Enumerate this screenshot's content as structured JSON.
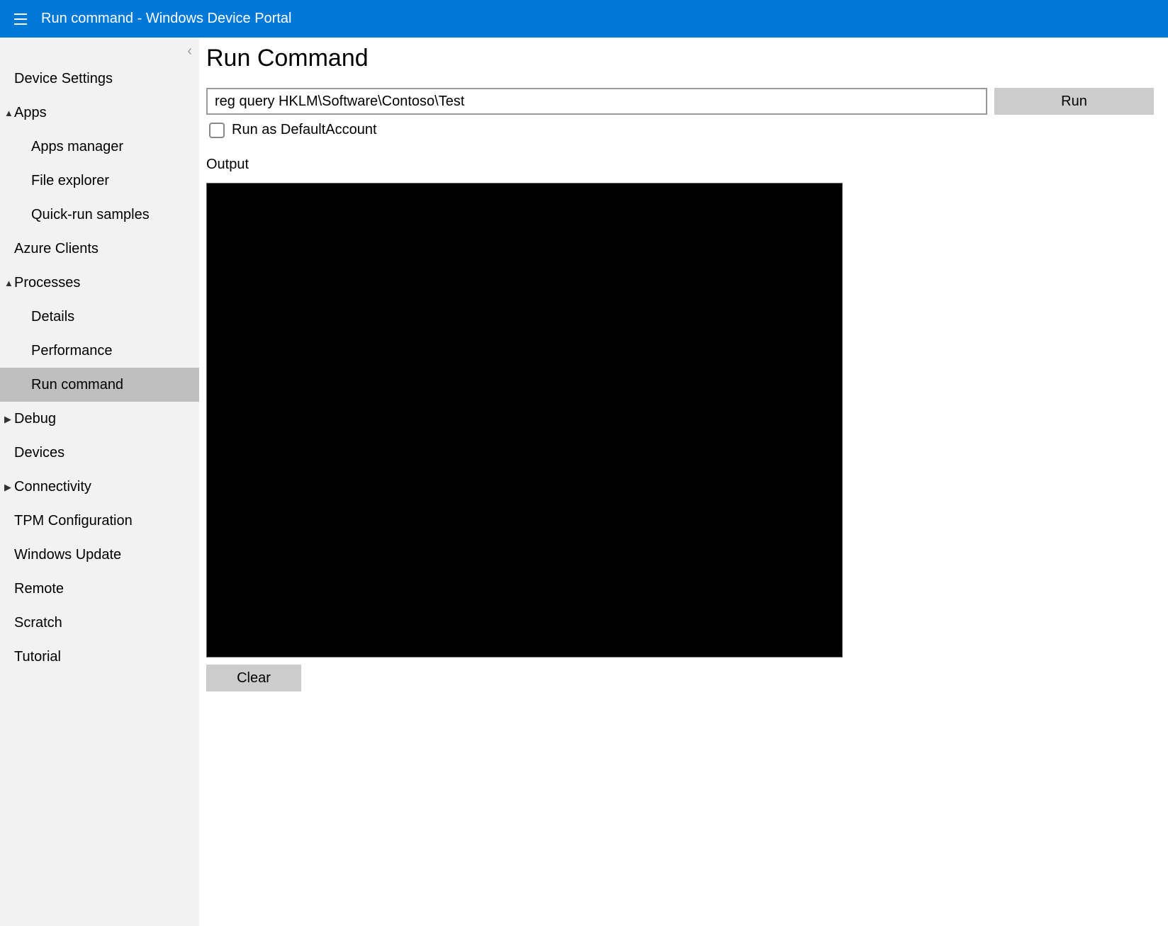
{
  "header": {
    "title": "Run command - Windows Device Portal"
  },
  "sidebar": {
    "items": [
      {
        "label": "Device Settings",
        "level": "top",
        "caret": "",
        "selected": false
      },
      {
        "label": "Apps",
        "level": "top",
        "caret": "▲",
        "selected": false
      },
      {
        "label": "Apps manager",
        "level": "sub",
        "caret": "",
        "selected": false
      },
      {
        "label": "File explorer",
        "level": "sub",
        "caret": "",
        "selected": false
      },
      {
        "label": "Quick-run samples",
        "level": "sub",
        "caret": "",
        "selected": false
      },
      {
        "label": "Azure Clients",
        "level": "top",
        "caret": "",
        "selected": false
      },
      {
        "label": "Processes",
        "level": "top",
        "caret": "▲",
        "selected": false
      },
      {
        "label": "Details",
        "level": "sub",
        "caret": "",
        "selected": false
      },
      {
        "label": "Performance",
        "level": "sub",
        "caret": "",
        "selected": false
      },
      {
        "label": "Run command",
        "level": "sub",
        "caret": "",
        "selected": true
      },
      {
        "label": "Debug",
        "level": "top",
        "caret": "▶",
        "selected": false
      },
      {
        "label": "Devices",
        "level": "top",
        "caret": "",
        "selected": false
      },
      {
        "label": "Connectivity",
        "level": "top",
        "caret": "▶",
        "selected": false
      },
      {
        "label": "TPM Configuration",
        "level": "top",
        "caret": "",
        "selected": false
      },
      {
        "label": "Windows Update",
        "level": "top",
        "caret": "",
        "selected": false
      },
      {
        "label": "Remote",
        "level": "top",
        "caret": "",
        "selected": false
      },
      {
        "label": "Scratch",
        "level": "top",
        "caret": "",
        "selected": false
      },
      {
        "label": "Tutorial",
        "level": "top",
        "caret": "",
        "selected": false
      }
    ],
    "collapse_glyph": "‹"
  },
  "main": {
    "title": "Run Command",
    "command_value": "reg query HKLM\\Software\\Contoso\\Test",
    "run_label": "Run",
    "run_as_default_label": "Run as DefaultAccount",
    "run_as_default_checked": false,
    "output_label": "Output",
    "output_text": "",
    "clear_label": "Clear"
  }
}
